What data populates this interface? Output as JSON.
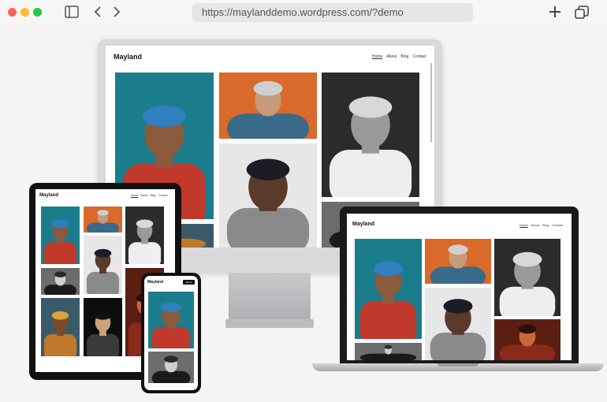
{
  "browser": {
    "url": "https://maylanddemo.wordpress.com/?demo",
    "traffic_colors": [
      "#ff5f57",
      "#febc2e",
      "#28c840"
    ]
  },
  "site": {
    "title": "Mayland",
    "nav": [
      "Home",
      "About",
      "Blog",
      "Contact"
    ],
    "phone_menu_label": "Menu"
  },
  "photos": [
    {
      "name": "woman-blue-headscarf",
      "bg": "#1b7d8c",
      "skin": "#8a5a3c",
      "cloth": "#c0392b",
      "hair": "#2f7fc1"
    },
    {
      "name": "painter-man",
      "bg": "#d96a2a",
      "skin": "#c79a7a",
      "cloth": "#3a6a8a",
      "hair": "#cfcfcf"
    },
    {
      "name": "old-man-grey-beard",
      "bg": "#2b2b2b",
      "skin": "#9a9a9a",
      "cloth": "#eeeeee",
      "hair": "#d8d8d8"
    },
    {
      "name": "boy-black-cap",
      "bg": "#e7e7e7",
      "skin": "#5a3a2a",
      "cloth": "#8a8a8a",
      "hair": "#1c1c24"
    },
    {
      "name": "monochrome-portrait",
      "bg": "#6c6c6c",
      "skin": "#cfcfcf",
      "cloth": "#1a1a1a",
      "hair": "#2a2a2a"
    },
    {
      "name": "colorful-hat",
      "bg": "#3a5a6a",
      "skin": "#7a4a2a",
      "cloth": "#c0782a",
      "hair": "#d9a23a"
    },
    {
      "name": "night-scene",
      "bg": "#0c0c0c",
      "skin": "#c9a27a",
      "cloth": "#3a3a3a",
      "hair": "#111111"
    },
    {
      "name": "red-warm-portrait",
      "bg": "#5a1f12",
      "skin": "#c9663a",
      "cloth": "#8a2a1a",
      "hair": "#2a1008"
    }
  ]
}
